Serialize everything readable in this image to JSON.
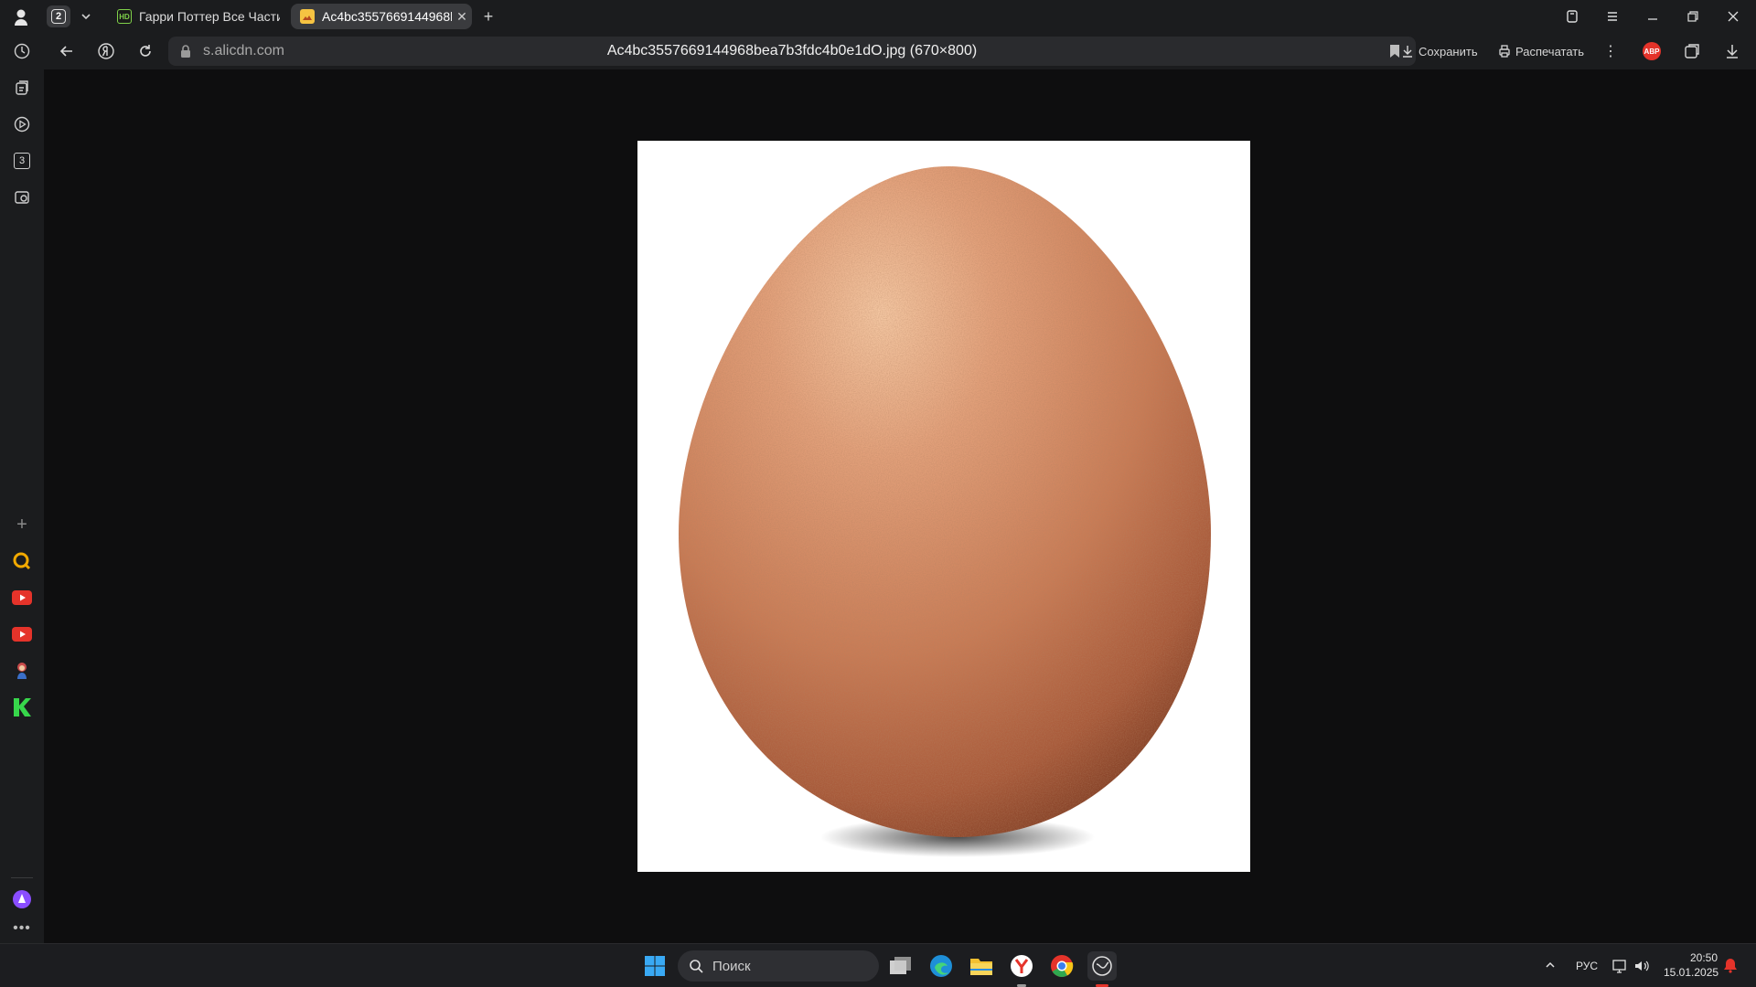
{
  "browser": {
    "tab_count": "2",
    "tabs": [
      {
        "label": "Гарри Поттер Все Части:",
        "favicon": "hd-icon"
      },
      {
        "label": "Ac4bc3557669144968b",
        "favicon": "image-file-icon"
      }
    ],
    "address": {
      "domain": "s.alicdn.com",
      "title": "Ac4bc3557669144968bea7b3fdc4b0e1dO.jpg (670×800)"
    },
    "toolbar": {
      "save_label": "Сохранить",
      "print_label": "Распечатать",
      "adblock_label": "ABP"
    }
  },
  "sidebar": {
    "badge_number": "3"
  },
  "image": {
    "subject": "egg",
    "background": "#ffffff"
  },
  "taskbar": {
    "search_placeholder": "Поиск",
    "language": "РУС",
    "time": "20:50",
    "date": "15.01.2025"
  },
  "colors": {
    "accent_red": "#e5332a",
    "accent_green": "#37d64b",
    "alice_purple": "#8a4dff"
  }
}
